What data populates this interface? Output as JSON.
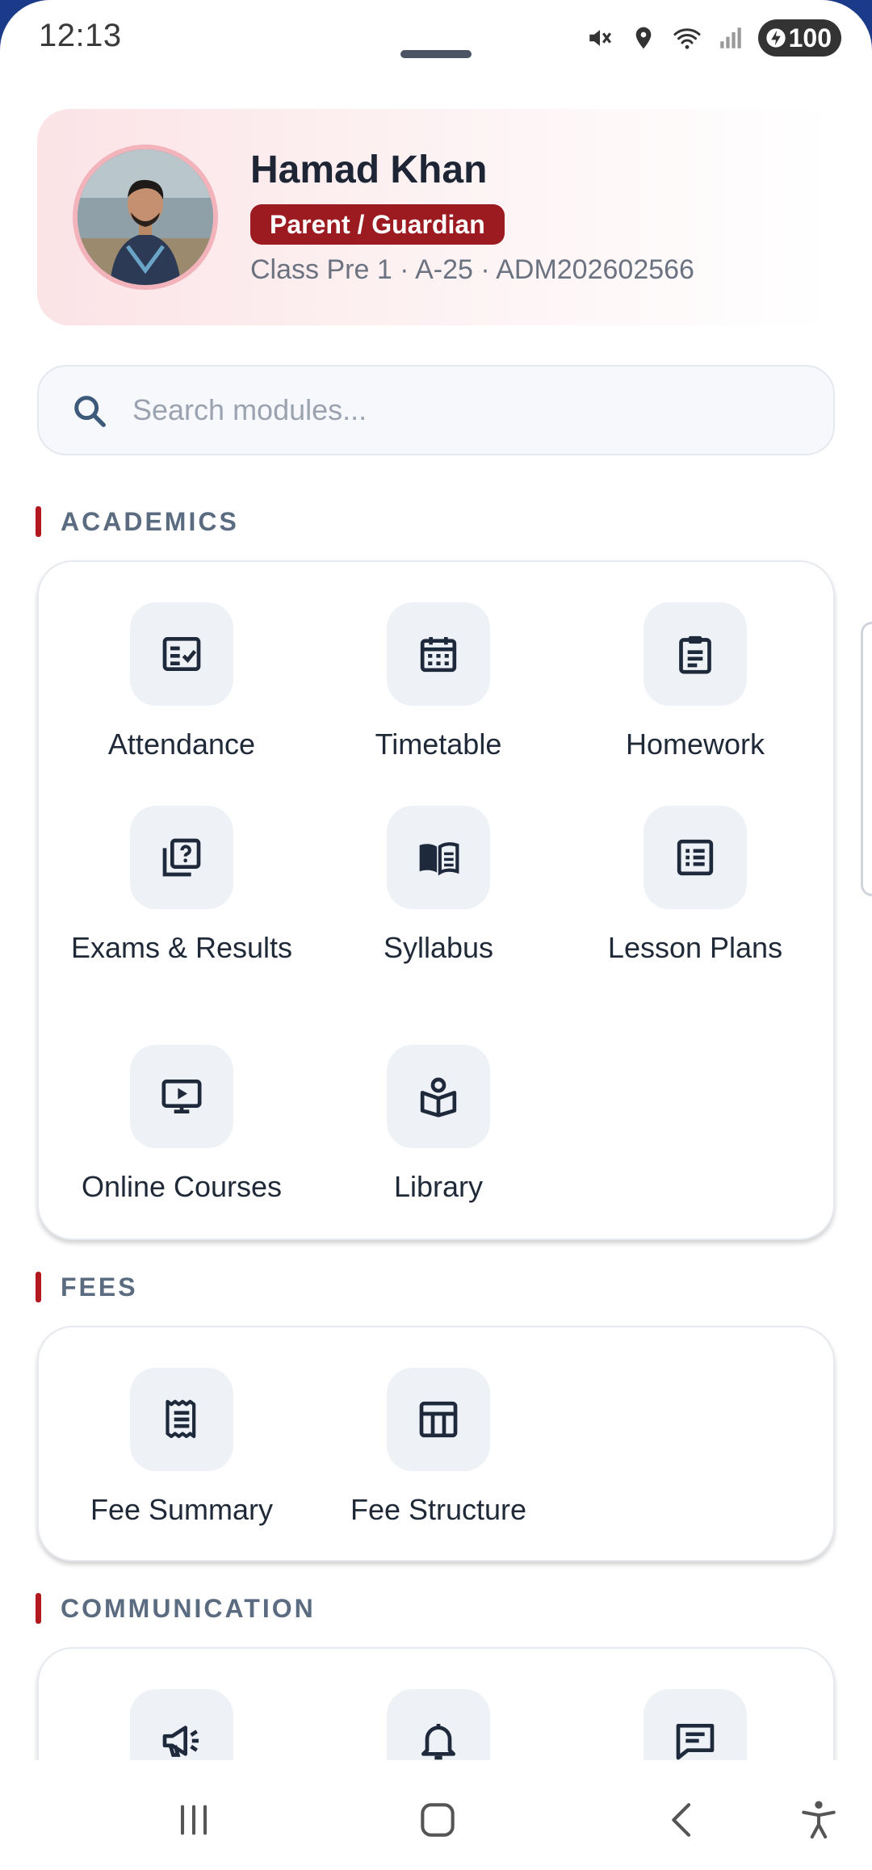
{
  "status_bar": {
    "time": "12:13",
    "battery": "100",
    "icons": [
      "mute-icon",
      "location-icon",
      "wifi-icon",
      "signal-icon",
      "battery-icon"
    ]
  },
  "profile": {
    "name": "Hamad Khan",
    "role": "Parent / Guardian",
    "meta": "Class Pre 1 · A-25 · ADM202602566"
  },
  "search": {
    "placeholder": "Search modules...",
    "value": ""
  },
  "sections": {
    "academics": {
      "title": "ACADEMICS",
      "items": [
        {
          "label": "Attendance",
          "icon": "attendance-icon"
        },
        {
          "label": "Timetable",
          "icon": "calendar-icon"
        },
        {
          "label": "Homework",
          "icon": "clipboard-icon"
        },
        {
          "label": "Exams & Results",
          "icon": "exam-icon"
        },
        {
          "label": "Syllabus",
          "icon": "book-icon"
        },
        {
          "label": "Lesson Plans",
          "icon": "list-icon"
        },
        {
          "label": "Online Courses",
          "icon": "video-icon"
        },
        {
          "label": "Library",
          "icon": "library-icon"
        }
      ]
    },
    "fees": {
      "title": "FEES",
      "items": [
        {
          "label": "Fee Summary",
          "icon": "receipt-icon"
        },
        {
          "label": "Fee Structure",
          "icon": "table-icon"
        }
      ]
    },
    "communication": {
      "title": "COMMUNICATION",
      "items": [
        {
          "label": "",
          "icon": "megaphone-icon"
        },
        {
          "label": "",
          "icon": "bell-icon"
        },
        {
          "label": "",
          "icon": "chat-icon"
        }
      ]
    }
  },
  "nav": {
    "buttons": [
      "recents-icon",
      "home-icon",
      "back-icon",
      "accessibility-icon"
    ]
  },
  "colors": {
    "accent": "#9b1b20",
    "section_bar": "#b3181f",
    "tile_bg": "#eef2f7",
    "icon": "#1e293b"
  }
}
